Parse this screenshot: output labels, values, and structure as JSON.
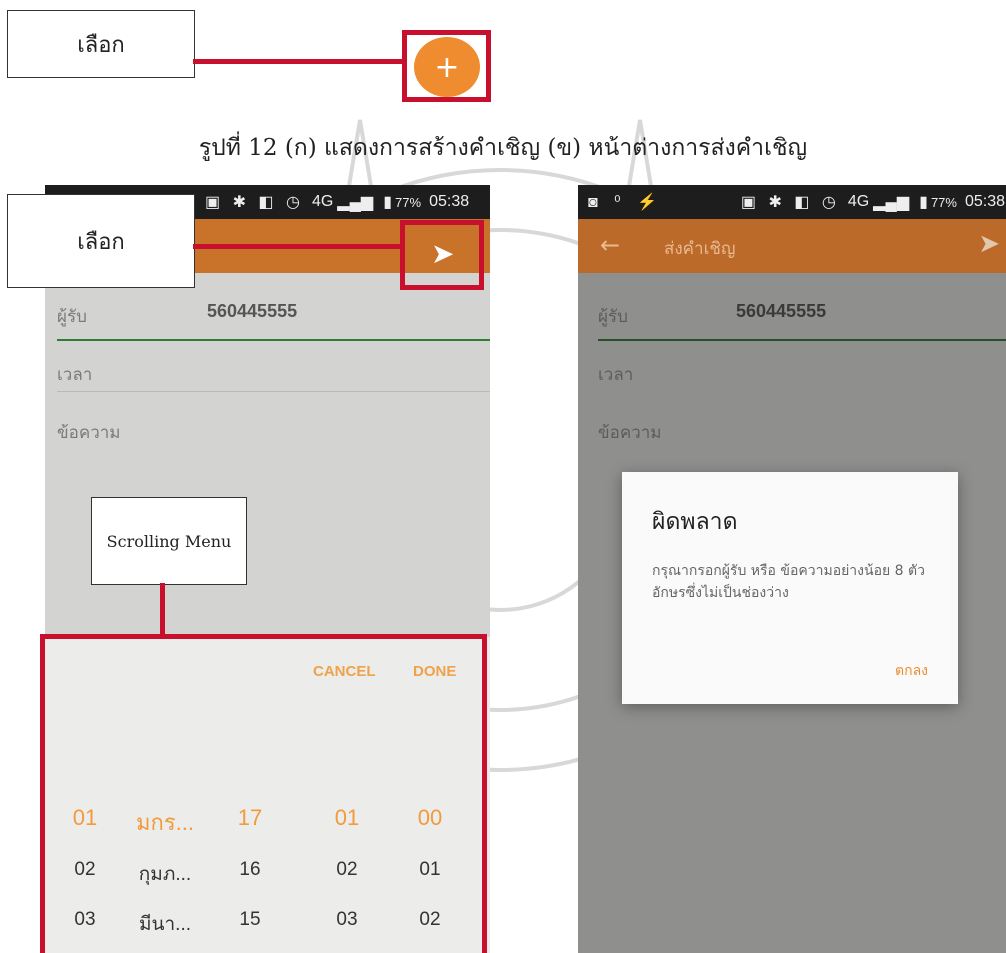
{
  "callouts": {
    "select_top": "เลือก",
    "select_mid": "เลือก",
    "scrolling_menu": "Scrolling Menu"
  },
  "caption": "รูปที่ 12 (ก) แสดงการสร้างคำเชิญ  (ข) หน้าต่างการส่งคำเชิญ",
  "left_screen": {
    "status": {
      "network": "4G",
      "battery": "77%",
      "time": "05:38"
    },
    "fields": {
      "recipient_label": "ผู้รับ",
      "recipient_value": "560445555",
      "time_label": "เวลา",
      "message_label": "ข้อความ"
    },
    "picker": {
      "cancel": "CANCEL",
      "done": "DONE",
      "rows": [
        [
          "01",
          "มกร...",
          "17",
          "01",
          "00"
        ],
        [
          "02",
          "กุมภ...",
          "16",
          "02",
          "01"
        ],
        [
          "03",
          "มีนา...",
          "15",
          "03",
          "02"
        ]
      ]
    }
  },
  "right_screen": {
    "status": {
      "network": "4G",
      "battery": "77%",
      "time": "05:38"
    },
    "appbar_title": "ส่งคำเชิญ",
    "fields": {
      "recipient_label": "ผู้รับ",
      "recipient_value": "560445555",
      "time_label": "เวลา",
      "message_label": "ข้อความ"
    },
    "dialog": {
      "title": "ผิดพลาด",
      "message": "กรุณากรอกผู้รับ หรือ ข้อความอย่างน้อย 8 ตัวอักษรซึ่งไม่เป็นช่องว่าง",
      "ok": "ตกลง"
    }
  },
  "colors": {
    "accent": "#c8722a",
    "highlight": "#c8102e",
    "picker_selected": "#f39a3c"
  }
}
